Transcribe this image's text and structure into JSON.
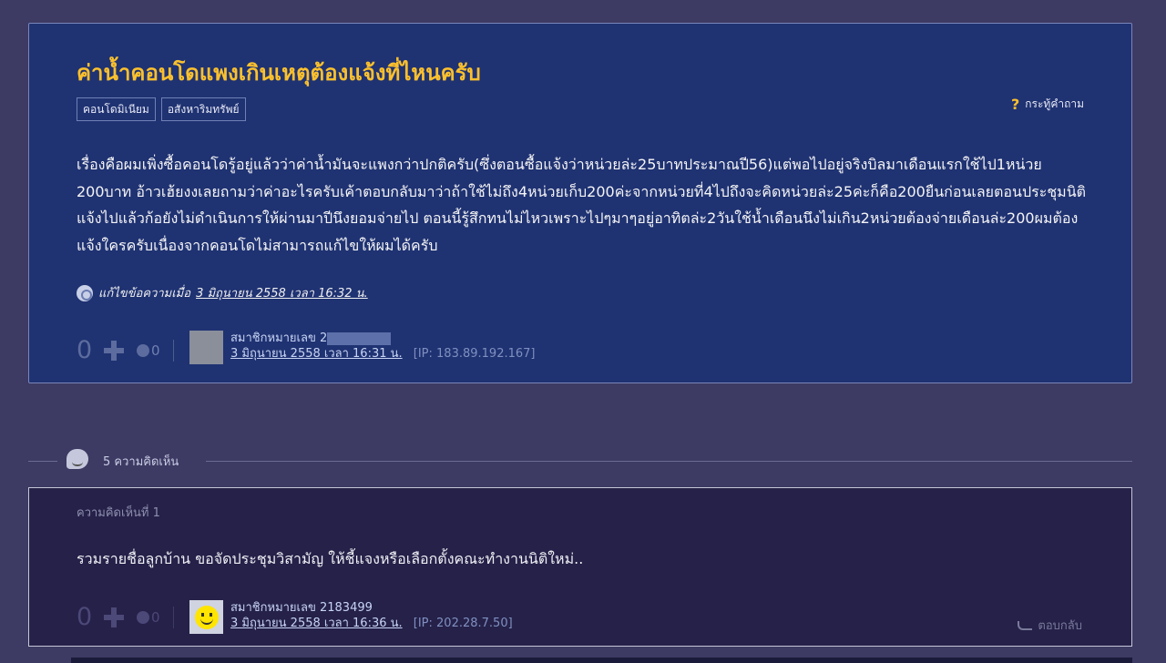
{
  "topic": {
    "title": "ค่าน้ำคอนโดแพงเกินเหตุต้องแจ้งที่ไหนครับ",
    "tags": [
      "คอนโดมิเนียม",
      "อสังหาริมทรัพย์"
    ],
    "badge_label": "กระทู้คำถาม",
    "body": "เรื่องคือผมเพิ่งซื้อคอนโดรู้อยู่แล้วว่าค่าน้ำมันจะแพงกว่าปกติครับ(ซึ่งตอนซื้อแจ้งว่าหน่วยล่ะ25บาทประมาณปี56)แต่พอไปอยู่จริงบิลมาเดือนแรกใช้ไป1หน่วย 200บาท อ้าวเฮ้ยงงเลยถามว่าค่าอะไรครับเค้าตอบกลับมาว่าถ้าใช้ไม่ถึง4หน่วยเก็บ200ค่ะจากหน่วยที่4ไปถึงจะคิดหน่วยล่ะ25ค่ะก็คือ200ยืนก่อนเลยตอนประชุมนิติแจ้งไปแล้วก้อยังไม่ดำเนินการให้ผ่านมาปีนึงยอมจ่ายไป ตอนนี้รู้สึกทนไม่ไหวเพราะไปๆมาๆอยู่อาทิตล่ะ2วันใช้น้ำเดือนนึงไม่เกิน2หน่วยต้องจ่ายเดือนล่ะ200ผมต้องแจ้งใครครับเนื่องจากคอนโดไม่สามารถแก้ไขให้ผมได้ครับ",
    "edit_prefix": "แก้ไขข้อความเมื่อ",
    "edit_date": "3 มิถุนายน 2558 เวลา 16:32 น.",
    "votes": "0",
    "emotions": "0",
    "author": {
      "name": "สมาชิกหมายเลข 2",
      "date": "3 มิถุนายน 2558 เวลา 16:31 น.",
      "ip": "[IP: 183.89.192.167]"
    }
  },
  "comments_header": {
    "count_label": "5 ความคิดเห็น"
  },
  "comment": {
    "number_label": "ความคิดเห็นที่ 1",
    "body": "รวมรายชื่อลูกบ้าน ขอจัดประชุมวิสามัญ ให้ชี้แจงหรือเลือกตั้งคณะทำงานนิติใหม่..",
    "votes": "0",
    "emotions": "0",
    "author": {
      "name": "สมาชิกหมายเลข 2183499",
      "date": "3 มิถุนายน 2558 เวลา 16:36 น.",
      "ip": "[IP: 202.28.7.50]"
    },
    "reply_label": "ตอบกลับ"
  }
}
